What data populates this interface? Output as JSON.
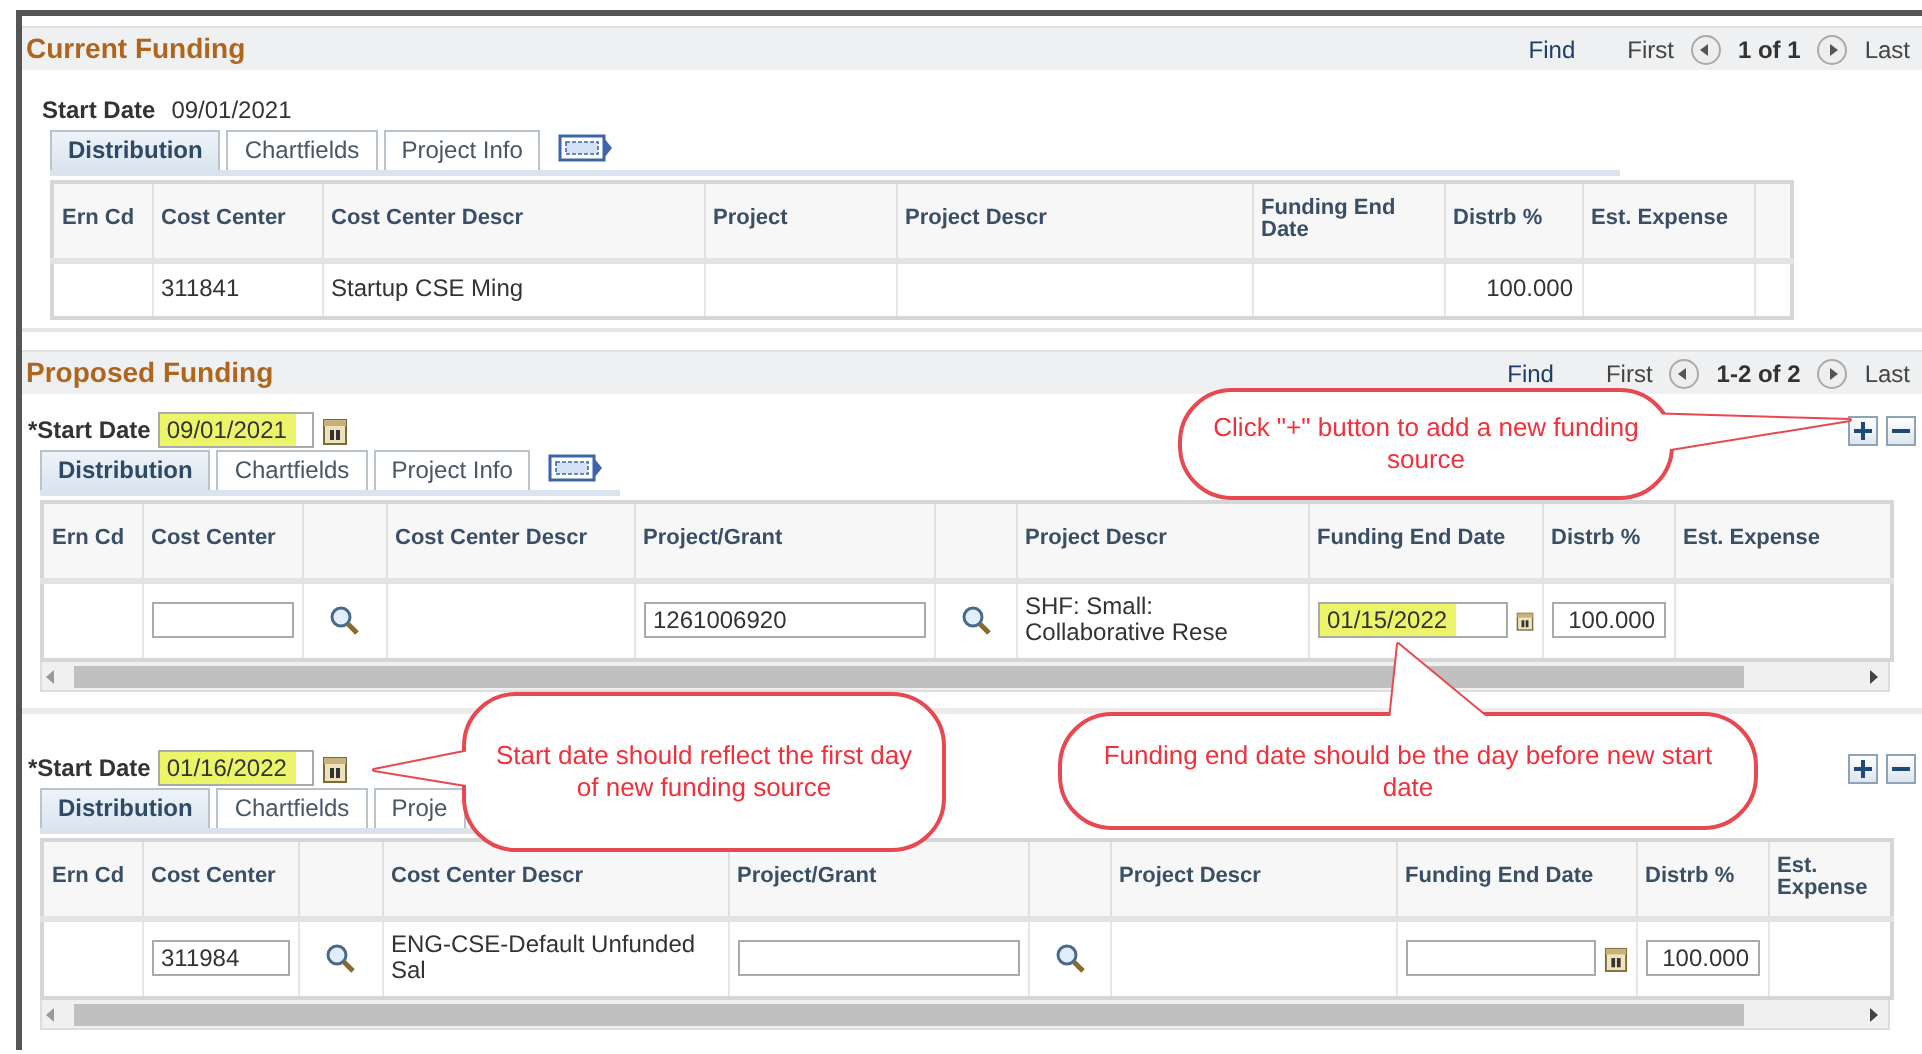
{
  "current_funding": {
    "title": "Current Funding",
    "pager": {
      "find": "Find",
      "first": "First",
      "range": "1 of 1",
      "last": "Last"
    },
    "entries": [
      {
        "start_date": {
          "label": "Start Date",
          "value": "09/01/2021"
        },
        "tabs": [
          {
            "label": "Distribution",
            "selected": true
          },
          {
            "label": "Chartfields",
            "selected": false
          },
          {
            "label": "Project Info",
            "selected": false
          }
        ],
        "tab_menu_icon": true,
        "table": {
          "columns": [
            {
              "label": "Ern Cd"
            },
            {
              "label": "Cost Center"
            },
            {
              "label": "Cost Center Descr"
            },
            {
              "label": "Project"
            },
            {
              "label": "Project Descr"
            },
            {
              "label": "Funding End Date"
            },
            {
              "label": "Distrb %"
            },
            {
              "label": "Est. Expense"
            }
          ],
          "rows": [
            {
              "cells": [
                {
                  "kind": "empty"
                },
                {
                  "kind": "text",
                  "text": "311841"
                },
                {
                  "kind": "text",
                  "text": "Startup CSE Ming"
                },
                {
                  "kind": "empty"
                },
                {
                  "kind": "empty"
                },
                {
                  "kind": "empty"
                },
                {
                  "kind": "number",
                  "text": "100.000"
                },
                {
                  "kind": "empty"
                }
              ]
            }
          ]
        }
      }
    ]
  },
  "proposed_funding": {
    "title": "Proposed Funding",
    "pager": {
      "find": "Find",
      "first": "First",
      "range": "1-2 of 2",
      "last": "Last"
    },
    "entries": [
      {
        "start_date": {
          "label": "*Start Date",
          "value": "09/01/2021",
          "highlighted": true
        },
        "tabs": [
          {
            "label": "Distribution",
            "selected": true
          },
          {
            "label": "Chartfields",
            "selected": false
          },
          {
            "label": "Project Info",
            "selected": false
          }
        ],
        "tab_menu_icon": true,
        "table": {
          "columns": [
            {
              "label": "Ern Cd"
            },
            {
              "label": "Cost Center"
            },
            {
              "kind": "lookup"
            },
            {
              "label": "Cost Center Descr"
            },
            {
              "label": "Project/Grant"
            },
            {
              "kind": "lookup"
            },
            {
              "label": "Project Descr"
            },
            {
              "label": "Funding End Date"
            },
            {
              "label": "Distrb %"
            },
            {
              "label": "Est. Expense"
            }
          ],
          "rows": [
            {
              "cells": [
                {
                  "kind": "empty"
                },
                {
                  "kind": "input"
                },
                {
                  "kind": "lookup"
                },
                {
                  "kind": "empty"
                },
                {
                  "kind": "input",
                  "value": "1261006920"
                },
                {
                  "kind": "lookup"
                },
                {
                  "kind": "text",
                  "text": "SHF: Small: Collaborative Rese"
                },
                {
                  "kind": "date",
                  "value": "01/15/2022",
                  "highlighted": true
                },
                {
                  "kind": "percent",
                  "value": "100.000"
                },
                {
                  "kind": "empty"
                }
              ]
            }
          ]
        }
      },
      {
        "start_date": {
          "label": "*Start Date",
          "value": "01/16/2022",
          "highlighted": true
        },
        "tabs": [
          {
            "label": "Distribution",
            "selected": true
          },
          {
            "label": "Chartfields",
            "selected": false
          },
          {
            "label": "Proje",
            "selected": false
          }
        ],
        "tab_menu_icon": false,
        "table": {
          "columns": [
            {
              "label": "Ern Cd"
            },
            {
              "label": "Cost Center"
            },
            {
              "kind": "lookup"
            },
            {
              "label": "Cost Center Descr"
            },
            {
              "label": "Project/Grant"
            },
            {
              "kind": "lookup"
            },
            {
              "label": "Project Descr"
            },
            {
              "label": "Funding End Date"
            },
            {
              "label": "Distrb %"
            },
            {
              "label": "Est. Expense"
            }
          ],
          "rows": [
            {
              "cells": [
                {
                  "kind": "empty"
                },
                {
                  "kind": "input",
                  "value": "311984"
                },
                {
                  "kind": "lookup"
                },
                {
                  "kind": "text",
                  "text": "ENG-CSE-Default Unfunded Sal"
                },
                {
                  "kind": "input"
                },
                {
                  "kind": "lookup"
                },
                {
                  "kind": "empty"
                },
                {
                  "kind": "date"
                },
                {
                  "kind": "percent",
                  "value": "100.000"
                },
                {
                  "kind": "empty"
                }
              ]
            }
          ]
        }
      }
    ]
  },
  "callouts": [
    {
      "text": "Click \"+\" button to add a new funding source"
    },
    {
      "text": "Start date should reflect the first day of new funding source"
    },
    {
      "text": "Funding end date should be the day before new start date"
    }
  ]
}
